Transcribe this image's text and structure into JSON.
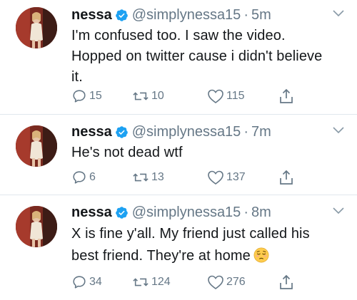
{
  "tweets": [
    {
      "name": "nessa",
      "handle": "@simplynessa15",
      "separator": "·",
      "time": "5m",
      "text_lines": [
        "I'm confused too. I saw the video.",
        "Hopped on twitter cause i didn't believe",
        "it."
      ],
      "replies": "15",
      "retweets": "10",
      "likes": "115"
    },
    {
      "name": "nessa",
      "handle": "@simplynessa15",
      "separator": "·",
      "time": "7m",
      "text_lines": [
        "He's not dead wtf"
      ],
      "replies": "6",
      "retweets": "13",
      "likes": "137"
    },
    {
      "name": "nessa",
      "handle": "@simplynessa15",
      "separator": "·",
      "time": "8m",
      "text_lines": [
        "X is fine y'all. My friend just called his",
        "best friend. They're at home"
      ],
      "emoji": "pensive-face",
      "replies": "34",
      "retweets": "124",
      "likes": "276"
    }
  ],
  "icons": {
    "verified": "verified-badge-icon",
    "menu": "chevron-down-icon",
    "reply": "reply-icon",
    "retweet": "retweet-icon",
    "like": "heart-icon",
    "share": "share-icon"
  },
  "colors": {
    "text": "#14171a",
    "secondary": "#657786",
    "verified": "#1da1f2",
    "divider": "#e1e8ed"
  }
}
